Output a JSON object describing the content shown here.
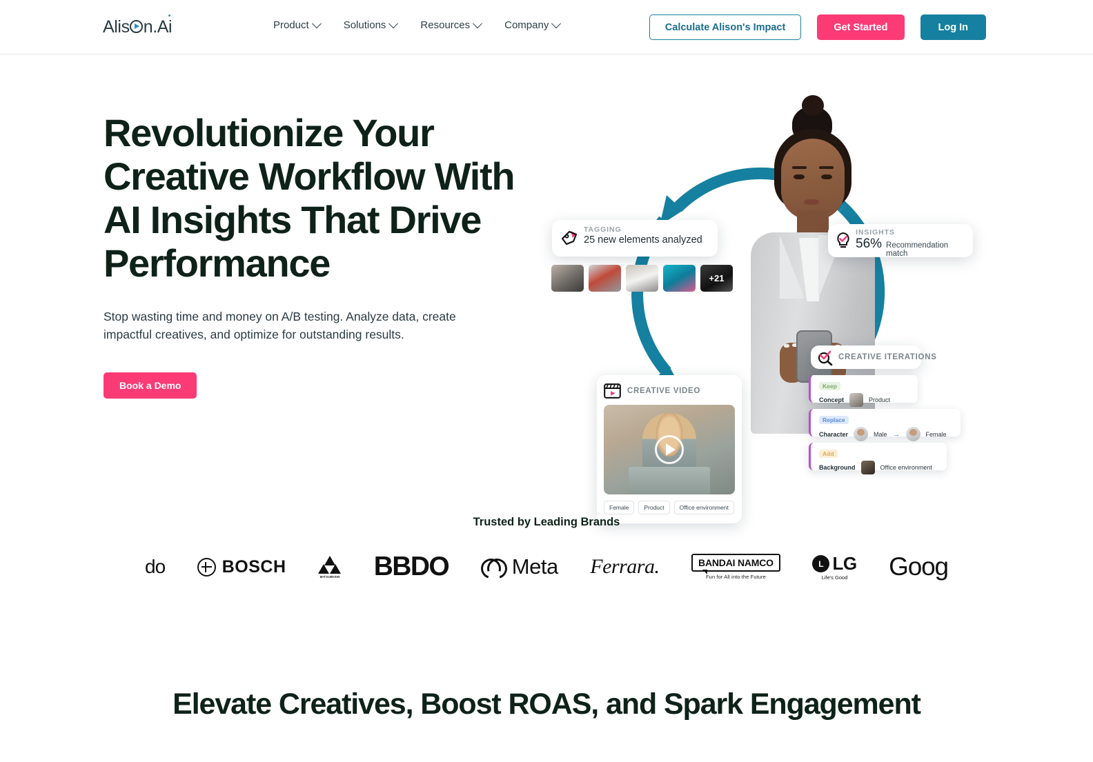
{
  "header": {
    "logo": {
      "pre": "Alis",
      "o_icon": "play-circle-icon",
      "post": "n.Ai"
    },
    "nav": [
      {
        "label": "Product",
        "icon": "chevron-down-icon"
      },
      {
        "label": "Solutions",
        "icon": "chevron-down-icon"
      },
      {
        "label": "Resources",
        "icon": "chevron-down-icon"
      },
      {
        "label": "Company",
        "icon": "chevron-down-icon"
      }
    ],
    "actions": {
      "calculate": "Calculate Alison's Impact",
      "get_started": "Get Started",
      "log_in": "Log In"
    }
  },
  "hero": {
    "title": "Revolutionize Your Creative Workflow With AI Insights That Drive Performance",
    "subtitle": "Stop wasting time and money on A/B testing. Analyze data, create impactful creatives, and optimize for outstanding results.",
    "cta": "Book a Demo",
    "cards": {
      "tagging": {
        "label": "TAGGING",
        "value": "25 new elements analyzed",
        "icon": "tag-icon",
        "thumbs_overflow": "+21"
      },
      "insights": {
        "label": "INSIGHTS",
        "percent": "56%",
        "text": "Recommendation match",
        "icon": "lightbulb-check-icon"
      },
      "creative_iterations": {
        "label": "CREATIVE ITERATIONS",
        "icon": "magnifier-check-icon",
        "rows": [
          {
            "badge": "Keep",
            "key": "Concept",
            "value": "Product"
          },
          {
            "badge": "Replace",
            "key": "Character",
            "from": "Male",
            "arrow": "→",
            "to": "Female"
          },
          {
            "badge": "Add",
            "key": "Background",
            "value": "Office environment"
          }
        ]
      },
      "creative_video": {
        "label": "CREATIVE VIDEO",
        "icon": "clapperboard-icon",
        "play_icon": "play-icon",
        "tags": [
          "Female",
          "Product",
          "Office environment"
        ]
      }
    }
  },
  "brands": {
    "title": "Trusted by Leading Brands",
    "items": [
      {
        "name": "udo",
        "text": "do"
      },
      {
        "name": "bosch",
        "text": "BOSCH"
      },
      {
        "name": "mitsubishi",
        "text": "MITSUBISHI"
      },
      {
        "name": "bbdo",
        "text": "BBDO"
      },
      {
        "name": "meta",
        "text": "Meta"
      },
      {
        "name": "ferrara",
        "text": "Ferrara."
      },
      {
        "name": "bandai-namco",
        "text": "BANDAI NAMCO",
        "sub": "Fun for All into the Future"
      },
      {
        "name": "lg",
        "text": "LG",
        "sub": "Life's Good",
        "mark": "L"
      },
      {
        "name": "google",
        "text": "Goog"
      }
    ]
  },
  "section": {
    "headline": "Elevate Creatives, Boost ROAS, and Spark Engagement"
  },
  "colors": {
    "pink": "#fc3b76",
    "teal": "#1680a0",
    "dark_green": "#0e2219",
    "purple": "#b44fd6"
  }
}
